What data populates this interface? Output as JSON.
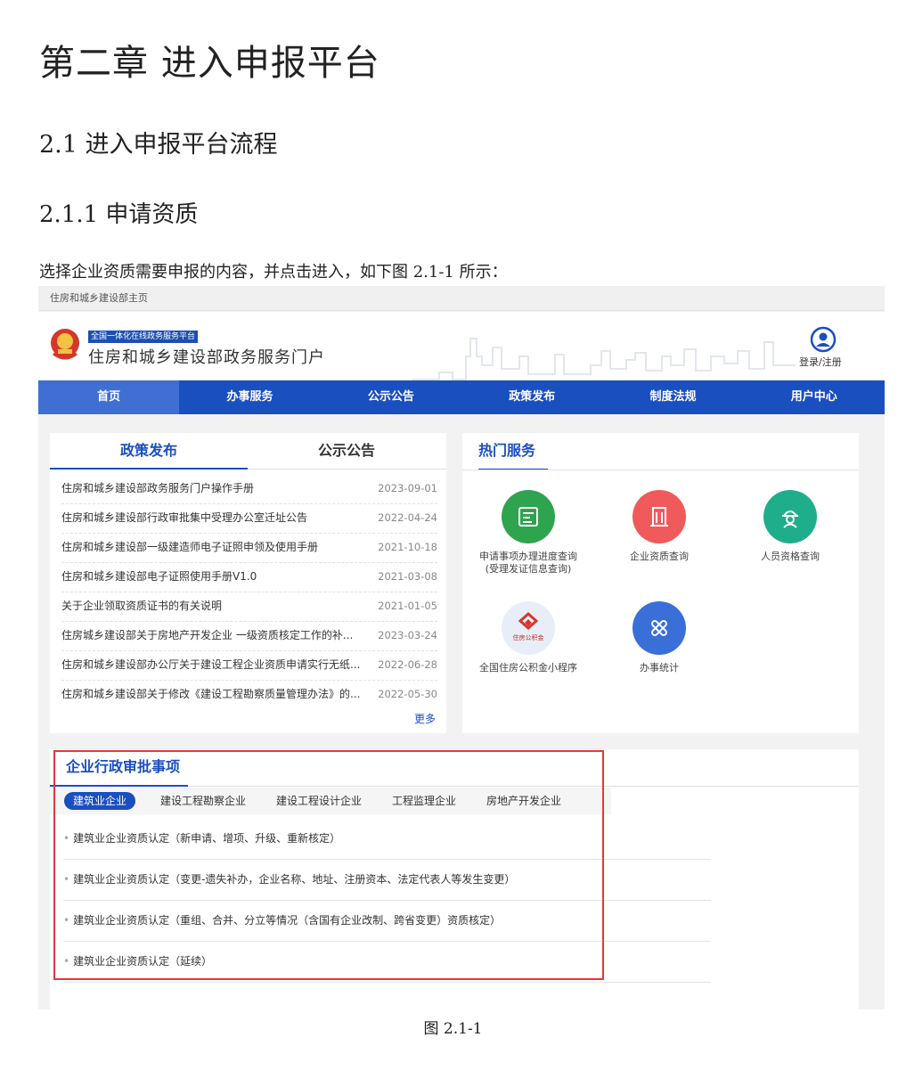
{
  "doc": {
    "chapter_title": "第二章  进入申报平台",
    "section_title": "2.1 进入申报平台流程",
    "subsection_title": "2.1.1 申请资质",
    "paragraph": "选择企业资质需要申报的内容，并点击进入，如下图 2.1-1 所示：",
    "figure_caption": "图 2.1-1"
  },
  "portal": {
    "top_link": "住房和城乡建设部主页",
    "platform_tag": "全国一体化在线政务服务平台",
    "title": "住房和城乡建设部政务服务门户",
    "login": "登录/注册",
    "nav": [
      "首页",
      "办事服务",
      "公示公告",
      "政策发布",
      "制度法规",
      "用户中心"
    ],
    "policy_panel": {
      "tabs": [
        "政策发布",
        "公示公告"
      ],
      "items": [
        {
          "title": "住房和城乡建设部政务服务门户操作手册",
          "date": "2023-09-01"
        },
        {
          "title": "住房和城乡建设部行政审批集中受理办公室迁址公告",
          "date": "2022-04-24"
        },
        {
          "title": "住房和城乡建设部一级建造师电子证照申领及使用手册",
          "date": "2021-10-18"
        },
        {
          "title": "住房和城乡建设部电子证照使用手册V1.0",
          "date": "2021-03-08"
        },
        {
          "title": "关于企业领取资质证书的有关说明",
          "date": "2021-01-05"
        },
        {
          "title": "住房城乡建设部关于房地产开发企业 一级资质核定工作的补...",
          "date": "2023-03-24"
        },
        {
          "title": "住房和城乡建设部办公厅关于建设工程企业资质申请实行无纸...",
          "date": "2022-06-28"
        },
        {
          "title": "住房和城乡建设部关于修改《建设工程勘察质量管理办法》的...",
          "date": "2022-05-30"
        }
      ],
      "more": "更多"
    },
    "hot_services": {
      "title": "热门服务",
      "items": [
        {
          "label1": "申请事项办理进度查询",
          "label2": "(受理发证信息查询)",
          "icon": "document-progress-icon",
          "color": "#2ea44f"
        },
        {
          "label1": "企业资质查询",
          "label2": "",
          "icon": "building-icon",
          "color": "#f05a5a"
        },
        {
          "label1": "人员资格查询",
          "label2": "",
          "icon": "worker-helmet-icon",
          "color": "#1fae8c"
        },
        {
          "label1": "全国住房公积金小程序",
          "label2": "",
          "icon": "housing-fund-logo-icon",
          "color": "#e8eef8"
        },
        {
          "label1": "办事统计",
          "label2": "",
          "icon": "tools-icon",
          "color": "#3b6fd8"
        }
      ],
      "logo_text": "住房公积金"
    },
    "approval": {
      "title": "企业行政审批事项",
      "subtabs": [
        "建筑业企业",
        "建设工程勘察企业",
        "建设工程设计企业",
        "工程监理企业",
        "房地产开发企业"
      ],
      "items": [
        "建筑业企业资质认定（新申请、增项、升级、重新核定）",
        "建筑业企业资质认定（变更-遗失补办，企业名称、地址、注册资本、法定代表人等发生变更）",
        "建筑业企业资质认定（重组、合并、分立等情况（含国有企业改制、跨省变更）资质核定）",
        "建筑业企业资质认定（延续）"
      ]
    }
  }
}
